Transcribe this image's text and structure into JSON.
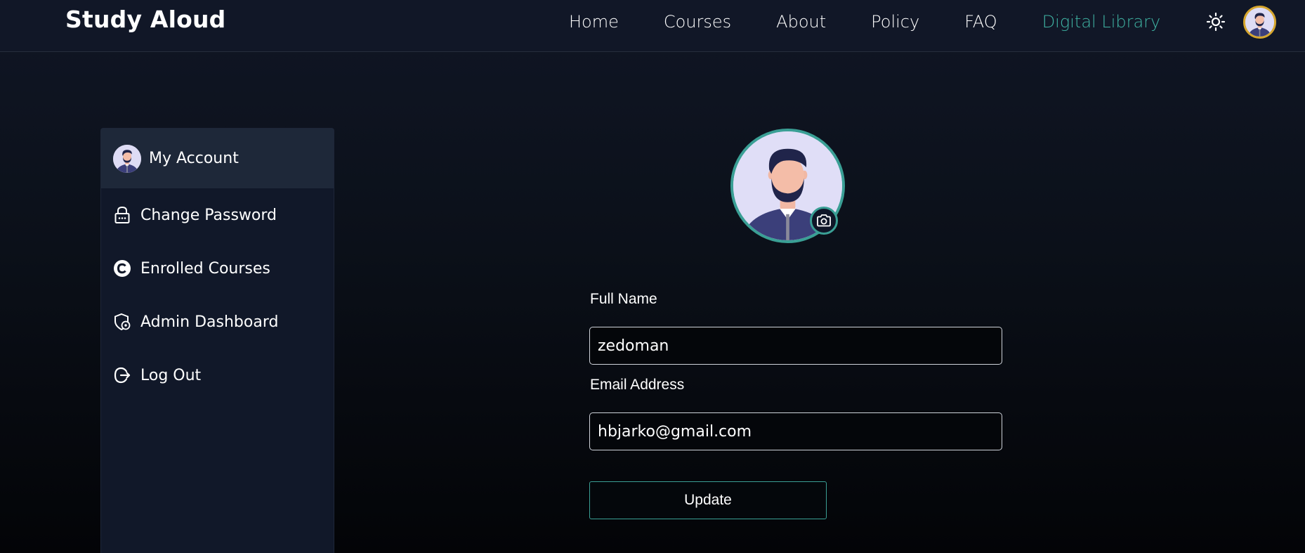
{
  "brand": "Study Aloud",
  "nav": {
    "links": [
      "Home",
      "Courses",
      "About",
      "Policy",
      "FAQ"
    ],
    "active_link": "Digital Library"
  },
  "theme_icon": "sun-icon",
  "colors": {
    "accent": "#3fb3a3",
    "avatar_ring": "#d6a62d",
    "profile_ring": "#3a9f95"
  },
  "sidebar": {
    "items": [
      {
        "label": "My Account",
        "icon": "avatar",
        "active": true
      },
      {
        "label": "Change Password",
        "icon": "lock-icon"
      },
      {
        "label": "Enrolled Courses",
        "icon": "copyright-icon"
      },
      {
        "label": "Admin Dashboard",
        "icon": "shield-settings-icon"
      },
      {
        "label": "Log Out",
        "icon": "logout-icon"
      }
    ]
  },
  "form": {
    "full_name_label": "Full Name",
    "full_name_value": "zedoman",
    "email_label": "Email Address",
    "email_value": "hbjarko@gmail.com",
    "submit_label": "Update"
  }
}
